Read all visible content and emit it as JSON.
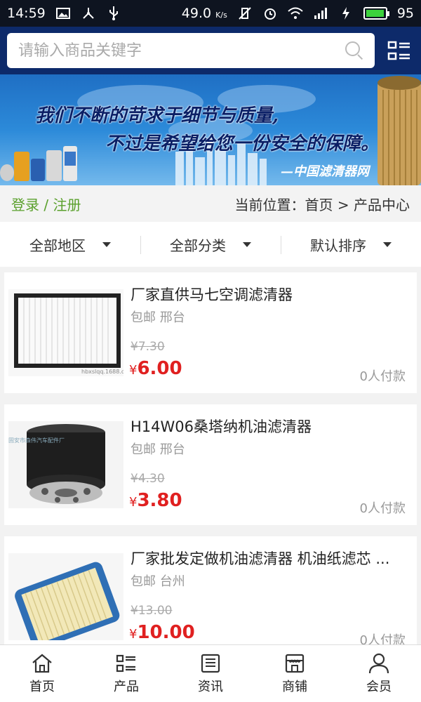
{
  "status_bar": {
    "time": "14:59",
    "net_speed": "49.0",
    "net_unit": "K/s",
    "battery_level": 95,
    "battery_text": "95",
    "battery_color": "#3cd23c"
  },
  "search": {
    "placeholder": "请输入商品关键字"
  },
  "banner": {
    "line1": "我们不断的苛求于细节与质量,",
    "line2": "不过是希望给您一份安全的保障。",
    "line3": "—中国滤清器网"
  },
  "crumb": {
    "login_label": "登录 / 注册",
    "location_label": "当前位置：首页 > 产品中心"
  },
  "filters": [
    {
      "label": "全部地区"
    },
    {
      "label": "全部分类"
    },
    {
      "label": "默认排序"
    }
  ],
  "products": [
    {
      "title": "厂家直供马七空调滤清器",
      "location": "包邮 邢台",
      "old_price": "¥7.30",
      "price_symbol": "¥",
      "price": "6.00",
      "paid": "0人付款",
      "thumb_watermark": "hbxslqq.1688.com"
    },
    {
      "title": "H14W06桑塔纳机油滤清器",
      "location": "包邮 邢台",
      "old_price": "¥4.30",
      "price_symbol": "¥",
      "price": "3.80",
      "paid": "0人付款",
      "thumb_watermark": "固安市森伟汽车配件厂"
    },
    {
      "title": "厂家批发定做机油滤清器 机油纸滤芯 ...",
      "location": "包邮 台州",
      "old_price": "¥13.00",
      "price_symbol": "¥",
      "price": "10.00",
      "paid": "0人付款"
    }
  ],
  "bottom_nav": [
    {
      "label": "首页",
      "icon": "home-icon"
    },
    {
      "label": "产品",
      "icon": "list-icon"
    },
    {
      "label": "资讯",
      "icon": "news-icon"
    },
    {
      "label": "商铺",
      "icon": "store-icon"
    },
    {
      "label": "会员",
      "icon": "user-icon"
    }
  ],
  "colors": {
    "header_bg": "#0d2a6a",
    "login_green": "#5aa02c",
    "price_red": "#e02020"
  }
}
